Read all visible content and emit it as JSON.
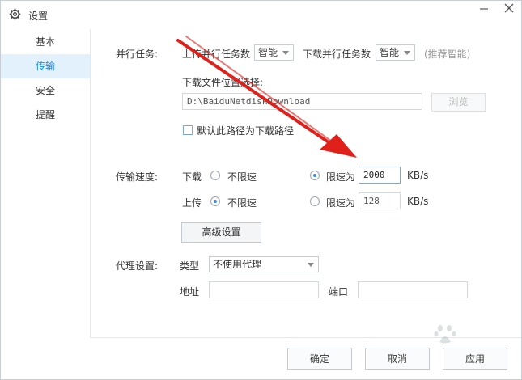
{
  "window": {
    "title": "设置",
    "icons": {
      "settings": "gear-icon",
      "minimize": "minimize-icon",
      "close": "close-icon"
    }
  },
  "sidebar": {
    "items": [
      {
        "label": "基本",
        "active": false
      },
      {
        "label": "传输",
        "active": true
      },
      {
        "label": "安全",
        "active": false
      },
      {
        "label": "提醒",
        "active": false
      }
    ]
  },
  "parallel": {
    "section_label": "并行任务:",
    "upload_label": "上传并行任务数",
    "upload_value": "智能",
    "download_label": "下载并行任务数",
    "download_value": "智能",
    "hint": "(推荐智能)"
  },
  "location": {
    "label": "下载文件位置选择:",
    "path": "D:\\BaiduNetdiskDownload",
    "browse_label": "浏览",
    "default_checkbox_label": "默认此路径为下载路径",
    "default_checked": false
  },
  "speed": {
    "section_label": "传输速度:",
    "download": {
      "label": "下载",
      "unlimited_label": "不限速",
      "unlimited_selected": false,
      "limit_label": "限速为",
      "limit_selected": true,
      "limit_value": "2000",
      "unit": "KB/s"
    },
    "upload": {
      "label": "上传",
      "unlimited_label": "不限速",
      "unlimited_selected": true,
      "limit_label": "限速为",
      "limit_selected": false,
      "limit_value": "128",
      "unit": "KB/s"
    },
    "advanced_label": "高级设置"
  },
  "proxy": {
    "section_label": "代理设置:",
    "type_label": "类型",
    "type_value": "不使用代理",
    "address_label": "地址",
    "address_value": "",
    "port_label": "端口",
    "port_value": ""
  },
  "footer": {
    "ok_label": "确定",
    "cancel_label": "取消",
    "apply_label": "应用"
  },
  "annotation": {
    "arrow_color": "#e0201b",
    "watermark_icon": "baidu-paw-icon"
  },
  "colors": {
    "accent": "#1d8de2",
    "sidebar_active_bg": "#e3f1fc",
    "radio_dot": "#3a8ee6"
  }
}
